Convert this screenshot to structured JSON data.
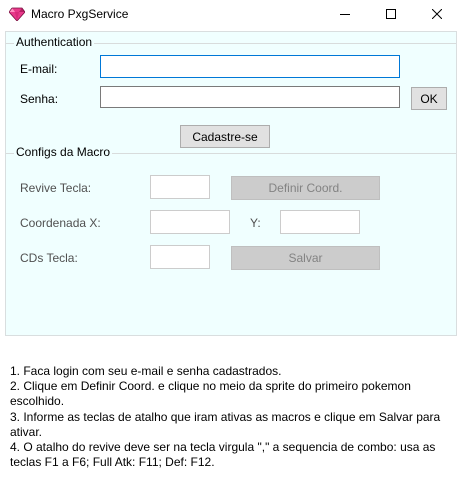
{
  "window": {
    "title": "Macro PxgService"
  },
  "auth": {
    "group_title": "Authentication",
    "email_label": "E-mail:",
    "email_value": "",
    "password_label": "Senha:",
    "password_value": "",
    "ok_label": "OK",
    "register_label": "Cadastre-se"
  },
  "macro": {
    "group_title": "Configs da Macro",
    "revive_label": "Revive Tecla:",
    "revive_value": "",
    "define_coord_label": "Definir Coord.",
    "coord_x_label": "Coordenada X:",
    "coord_x_value": "",
    "coord_y_label": "Y:",
    "coord_y_value": "",
    "cds_label": "CDs Tecla:",
    "cds_value": "",
    "save_label": "Salvar"
  },
  "instructions": [
    "1. Faca login com seu e-mail e senha cadastrados.",
    "2. Clique em Definir Coord. e clique no meio da sprite do primeiro pokemon escolhido.",
    "3. Informe as teclas de atalho que iram ativas as macros e clique em Salvar para ativar.",
    "4. O atalho do revive deve ser na tecla virgula \",\" a sequencia de combo: usa as teclas F1 a F6; Full Atk: F11; Def: F12."
  ],
  "icons": {
    "app": "pink-gem-icon",
    "minimize": "minimize-icon",
    "maximize": "maximize-icon",
    "close": "close-icon"
  },
  "colors": {
    "client_bg": "#f0ffff",
    "focus_border": "#0078d7",
    "icon_pink": "#e8388a"
  }
}
